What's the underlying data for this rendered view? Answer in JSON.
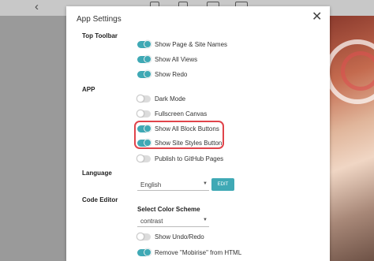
{
  "modal": {
    "title": "App Settings",
    "close_symbol": "✕"
  },
  "sections": {
    "top_toolbar": "Top Toolbar",
    "app": "APP",
    "language": "Language",
    "code_editor": "Code Editor"
  },
  "top_toolbar_options": [
    {
      "label": "Show Page & Site Names",
      "on": true
    },
    {
      "label": "Show All Views",
      "on": true
    },
    {
      "label": "Show Redo",
      "on": true
    }
  ],
  "app_options": [
    {
      "label": "Dark Mode",
      "on": false
    },
    {
      "label": "Fullscreen Canvas",
      "on": false
    },
    {
      "label": "Show All Block Buttons",
      "on": true
    },
    {
      "label": "Show Site Styles Button",
      "on": true
    },
    {
      "label": "Publish to GitHub Pages",
      "on": false
    }
  ],
  "language": {
    "selected": "English",
    "edit_button": "EDIT"
  },
  "code_editor": {
    "color_scheme_label": "Select Color Scheme",
    "color_scheme_selected": "contrast",
    "options": [
      {
        "label": "Show Undo/Redo",
        "on": false
      },
      {
        "label": "Remove \"Mobirise\" from HTML",
        "on": true
      }
    ]
  },
  "colors": {
    "accent": "#3fa9b5",
    "highlight": "#e0444b"
  }
}
